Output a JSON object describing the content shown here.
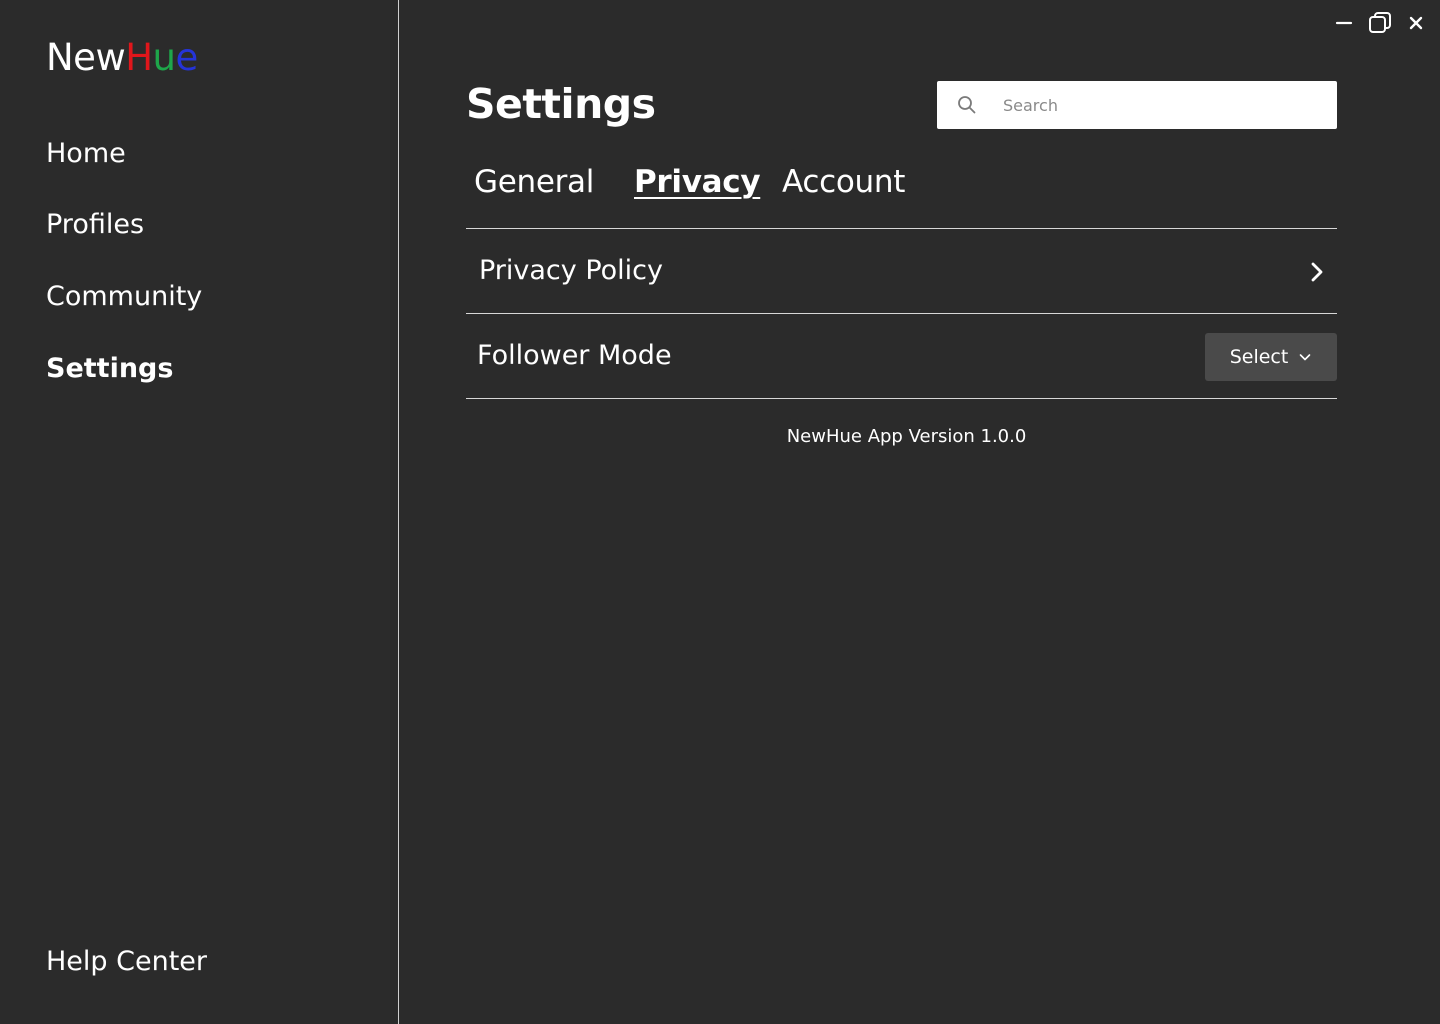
{
  "app": {
    "logo": {
      "part1": "New",
      "part2": "H",
      "part3": "u",
      "part4": "e"
    },
    "colors": {
      "background": "#2b2b2b",
      "logo_red": "#e0161b",
      "logo_green": "#1ea64a",
      "logo_blue": "#2534d8",
      "select_bg": "#4a4a4a"
    }
  },
  "sidebar": {
    "items": [
      {
        "label": "Home",
        "active": false
      },
      {
        "label": "Profiles",
        "active": false
      },
      {
        "label": "Community",
        "active": false
      },
      {
        "label": "Settings",
        "active": true
      }
    ],
    "footer_item": {
      "label": "Help Center"
    }
  },
  "window_controls": {
    "icons": [
      "minimize-icon",
      "restore-icon",
      "close-icon"
    ]
  },
  "header": {
    "title": "Settings",
    "search": {
      "placeholder": "Search",
      "value": "",
      "icon": "search-icon"
    }
  },
  "tabs": [
    {
      "label": "General",
      "active": false
    },
    {
      "label": "Privacy",
      "active": true
    },
    {
      "label": "Account",
      "active": false
    }
  ],
  "settings_rows": [
    {
      "label": "Privacy Policy",
      "control": "chevron-right-icon"
    },
    {
      "label": "Follower Mode",
      "control": "select",
      "select_value": "Select",
      "select_icon": "chevron-down-icon"
    }
  ],
  "footer": {
    "version_text": "NewHue App Version 1.0.0"
  }
}
